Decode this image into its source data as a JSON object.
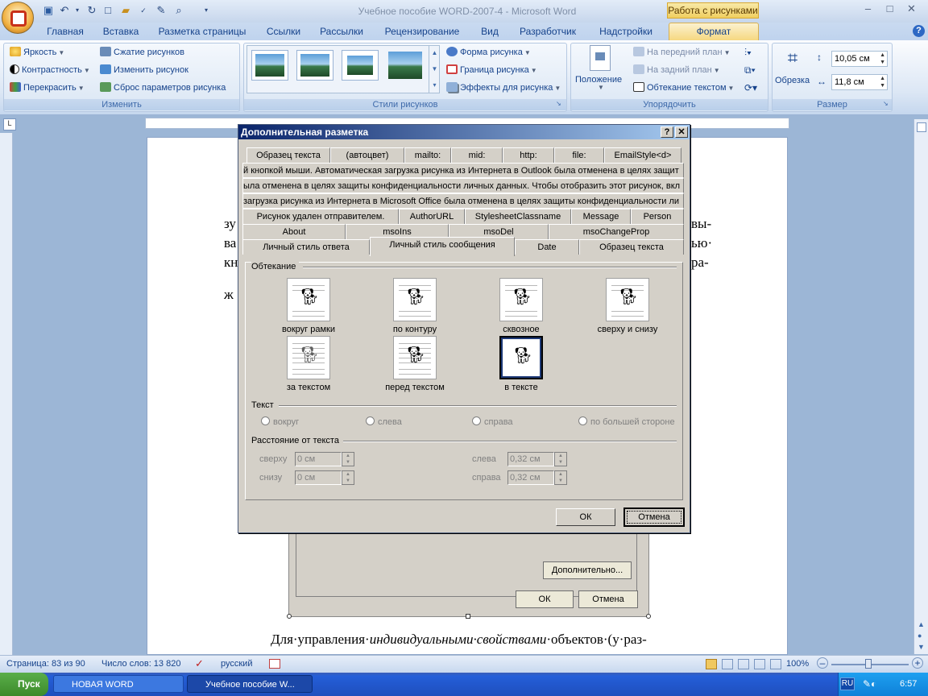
{
  "window": {
    "title": "Учебное пособие WORD-2007-4 - Microsoft Word",
    "context_group": "Работа с рисунками"
  },
  "tabs": [
    "Главная",
    "Вставка",
    "Разметка страницы",
    "Ссылки",
    "Рассылки",
    "Рецензирование",
    "Вид",
    "Разработчик",
    "Надстройки"
  ],
  "active_tab": "Формат",
  "ribbon": {
    "change": {
      "label": "Изменить",
      "brightness": "Яркость",
      "contrast": "Контрастность",
      "recolor": "Перекрасить",
      "compress": "Сжатие рисунков",
      "change_picture": "Изменить рисунок",
      "reset": "Сброс параметров рисунка"
    },
    "styles": {
      "label": "Стили рисунков",
      "shape": "Форма рисунка",
      "border": "Граница рисунка",
      "effects": "Эффекты для рисунка"
    },
    "arrange": {
      "label": "Упорядочить",
      "position": "Положение",
      "bring_front": "На передний план",
      "send_back": "На задний план",
      "wrap": "Обтекание текстом"
    },
    "size": {
      "label": "Размер",
      "crop": "Обрезка",
      "height": "10,05 см",
      "width": "11,8 см"
    }
  },
  "ruler": {
    "corner": "L"
  },
  "document": {
    "left_col": [
      "зу",
      "ва",
      "кн",
      "ж"
    ],
    "right_col": [
      "вы-",
      "ью·",
      "ра-"
    ],
    "bottom_line": "Для·управления·",
    "bottom_italic": "индивидуальными·свойствами",
    "bottom_rest": "·объектов·(у·раз-"
  },
  "bg_dialog": {
    "more": "Дополнительно...",
    "ok": "ОК",
    "cancel": "Отмена"
  },
  "dialog": {
    "title": "Дополнительная разметка",
    "help": "?",
    "close": "✕",
    "tabs_row1": [
      "Образец текста",
      "(автоцвет)",
      "mailto:",
      "mid:",
      "http:",
      "file:",
      "EmailStyle<d>"
    ],
    "msg1": "й кнопкой мыши. Автоматическая загрузка рисунка из Интернета в Outlook была отменена в целях защит",
    "msg2": "ыла отменена в целях защиты конфиденциальности личных данных. Чтобы отобразить этот рисунок, вкл",
    "msg3": "загрузка рисунка из Интернета в Microsoft Office была отменена в целях защиты конфиденциальности ли",
    "tabs_row2": [
      "Рисунок удален отправителем.",
      "AuthorURL",
      "StylesheetClassname",
      "Message",
      "Person"
    ],
    "tabs_row3": [
      "About",
      "msoIns",
      "msoDel",
      "msoChangeProp"
    ],
    "tabs_row4": [
      "Личный стиль ответа",
      "Личный стиль сообщения",
      "Date",
      "Образец текста"
    ],
    "wrap_section": "Обтекание",
    "wrap_options": [
      "вокруг рамки",
      "по контуру",
      "сквозное",
      "сверху и снизу",
      "за текстом",
      "перед текстом",
      "в тексте"
    ],
    "text_section": "Текст",
    "text_options": [
      "вокруг",
      "слева",
      "справа",
      "по большей стороне"
    ],
    "distance_section": "Расстояние от текста",
    "dist": {
      "top_label": "сверху",
      "top": "0 см",
      "bottom_label": "снизу",
      "bottom": "0 см",
      "left_label": "слева",
      "left": "0,32 см",
      "right_label": "справа",
      "right": "0,32 см"
    },
    "ok": "ОК",
    "cancel": "Отмена"
  },
  "status": {
    "page": "Страница: 83 из 90",
    "words": "Число слов: 13 820",
    "lang": "русский",
    "zoom": "100%"
  },
  "taskbar": {
    "start": "Пуск",
    "task1": "НОВАЯ WORD",
    "task2": "Учебное пособие W...",
    "lang": "RU",
    "time": "6:57"
  }
}
